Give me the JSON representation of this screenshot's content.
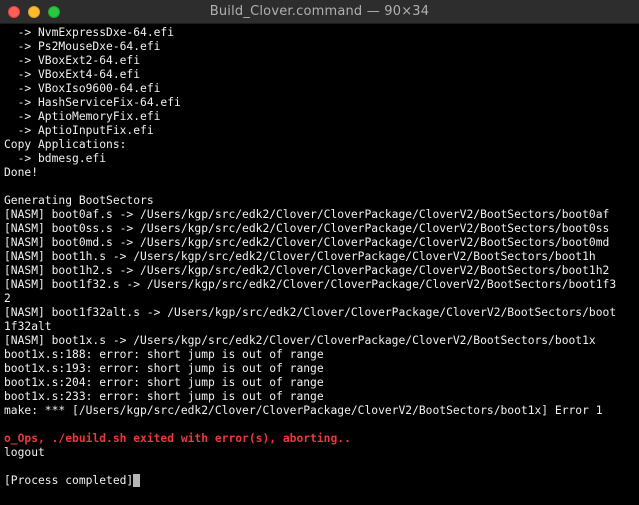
{
  "window": {
    "title": "Build_Clover.command — 90×34"
  },
  "terminal": {
    "lines": [
      "  -> NvmExpressDxe-64.efi",
      "  -> Ps2MouseDxe-64.efi",
      "  -> VBoxExt2-64.efi",
      "  -> VBoxExt4-64.efi",
      "  -> VBoxIso9600-64.efi",
      "  -> HashServiceFix-64.efi",
      "  -> AptioMemoryFix.efi",
      "  -> AptioInputFix.efi",
      "Copy Applications:",
      "  -> bdmesg.efi",
      "Done!",
      "",
      "Generating BootSectors",
      "[NASM] boot0af.s -> /Users/kgp/src/edk2/Clover/CloverPackage/CloverV2/BootSectors/boot0af",
      "[NASM] boot0ss.s -> /Users/kgp/src/edk2/Clover/CloverPackage/CloverV2/BootSectors/boot0ss",
      "[NASM] boot0md.s -> /Users/kgp/src/edk2/Clover/CloverPackage/CloverV2/BootSectors/boot0md",
      "[NASM] boot1h.s -> /Users/kgp/src/edk2/Clover/CloverPackage/CloverV2/BootSectors/boot1h",
      "[NASM] boot1h2.s -> /Users/kgp/src/edk2/Clover/CloverPackage/CloverV2/BootSectors/boot1h2",
      "[NASM] boot1f32.s -> /Users/kgp/src/edk2/Clover/CloverPackage/CloverV2/BootSectors/boot1f3",
      "2",
      "[NASM] boot1f32alt.s -> /Users/kgp/src/edk2/Clover/CloverPackage/CloverV2/BootSectors/boot",
      "1f32alt",
      "[NASM] boot1x.s -> /Users/kgp/src/edk2/Clover/CloverPackage/CloverV2/BootSectors/boot1x",
      "boot1x.s:188: error: short jump is out of range",
      "boot1x.s:193: error: short jump is out of range",
      "boot1x.s:204: error: short jump is out of range",
      "boot1x.s:233: error: short jump is out of range",
      "make: *** [/Users/kgp/src/edk2/Clover/CloverPackage/CloverV2/BootSectors/boot1x] Error 1",
      "",
      "o_Ops, ./ebuild.sh exited with error(s), aborting..",
      "logout",
      "",
      "[Process completed]"
    ]
  },
  "colors": {
    "background": "#000000",
    "text": "#f0f0f0",
    "error": "#e8393d",
    "titlebar": "#2d2d2d"
  }
}
